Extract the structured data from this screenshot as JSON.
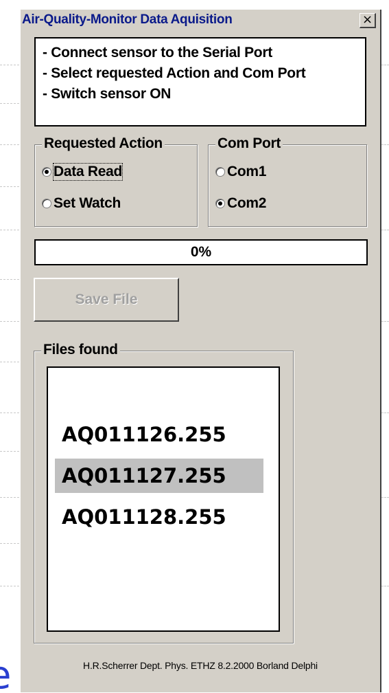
{
  "window": {
    "title": "Air-Quality-Monitor Data Aquisition",
    "close_symbol": "×"
  },
  "instructions": [
    "- Connect sensor to the Serial Port",
    "- Select requested Action and Com Port",
    "- Switch sensor ON"
  ],
  "requested_action": {
    "legend": "Requested Action",
    "options": [
      {
        "label": "Data Read",
        "checked": true
      },
      {
        "label": "Set Watch",
        "checked": false
      }
    ]
  },
  "com_port": {
    "legend": "Com Port",
    "options": [
      {
        "label": "Com1",
        "checked": false
      },
      {
        "label": "Com2",
        "checked": true
      }
    ]
  },
  "progress": {
    "label": "0%",
    "value": 0
  },
  "save_button": {
    "label": "Save File",
    "enabled": false
  },
  "files": {
    "legend": "Files found",
    "items": [
      {
        "name": "AQ011126.255",
        "selected": false
      },
      {
        "name": "AQ011127.255",
        "selected": true
      },
      {
        "name": "AQ011128.255",
        "selected": false
      }
    ]
  },
  "footer": "H.R.Scherrer Dept. Phys. ETHZ 8.2.2000  Borland Delphi",
  "background_fragment": "e",
  "colors": {
    "face": "#d4d0c8",
    "title_text": "#0a1a8a",
    "selection": "#c0c0c0",
    "disabled_text": "#a0a0a0",
    "background_letter": "#2a3fd0"
  }
}
